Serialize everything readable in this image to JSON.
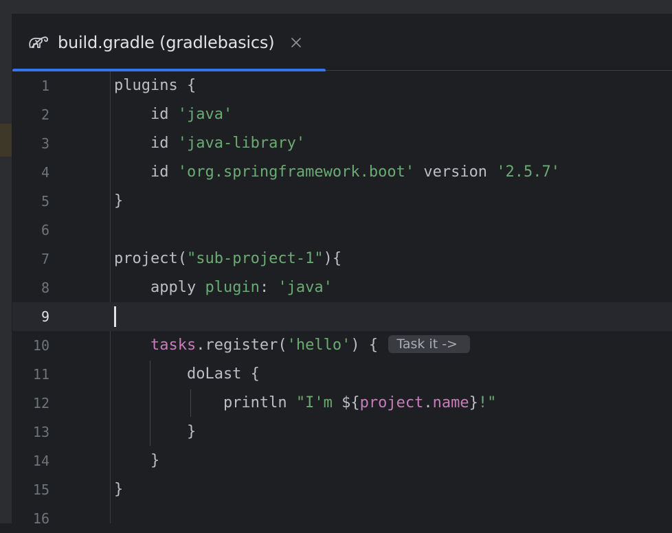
{
  "tab": {
    "title": "build.gradle (gradlebasics)",
    "icon": "gradle-elephant-icon",
    "close_glyph": "×"
  },
  "editor": {
    "current_line": 9,
    "lines": [
      {
        "n": "1"
      },
      {
        "n": "2"
      },
      {
        "n": "3"
      },
      {
        "n": "4"
      },
      {
        "n": "5"
      },
      {
        "n": "6"
      },
      {
        "n": "7"
      },
      {
        "n": "8"
      },
      {
        "n": "9"
      },
      {
        "n": "10"
      },
      {
        "n": "11"
      },
      {
        "n": "12"
      },
      {
        "n": "13"
      },
      {
        "n": "14"
      },
      {
        "n": "15"
      },
      {
        "n": "16"
      }
    ],
    "code": {
      "l1": "plugins {",
      "l2_kw": "    id ",
      "l2_str": "'java'",
      "l3_kw": "    id ",
      "l3_str": "'java-library'",
      "l4_kw": "    id ",
      "l4_str": "'org.springframework.boot'",
      "l4_mid": " version ",
      "l4_ver": "'2.5.7'",
      "l5": "}",
      "l7_a": "project(",
      "l7_str": "\"sub-project-1\"",
      "l7_b": "){",
      "l8_a": "    apply ",
      "l8_plugin": "plugin",
      "l8_b": ": ",
      "l8_str": "'java'",
      "l10_indent": "    ",
      "l10_tasks": "tasks",
      "l10_a": ".register(",
      "l10_str": "'hello'",
      "l10_b": ") { ",
      "l10_hint": "Task it ->",
      "l11": "        doLast {",
      "l12_a": "            println ",
      "l12_s1": "\"I'm ",
      "l12_d": "${",
      "l12_p1": "project",
      "l12_dot": ".",
      "l12_p2": "name",
      "l12_e": "}",
      "l12_s2": "!\"",
      "l13": "        }",
      "l14": "    }",
      "l15": "}"
    }
  },
  "colors": {
    "background": "#1e1f22",
    "accent": "#3574f0",
    "string": "#6aab73",
    "property": "#c77dbb",
    "text": "#bcbec4"
  }
}
